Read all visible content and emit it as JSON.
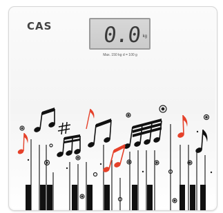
{
  "brand": "CAS",
  "display": {
    "reading": "0.0",
    "unit": "kg"
  },
  "capacity_label": "Max. 150 kg   d = 100 g",
  "colors": {
    "note_black": "#111111",
    "note_red": "#e5412a",
    "lcd": "#d0d0d0"
  }
}
